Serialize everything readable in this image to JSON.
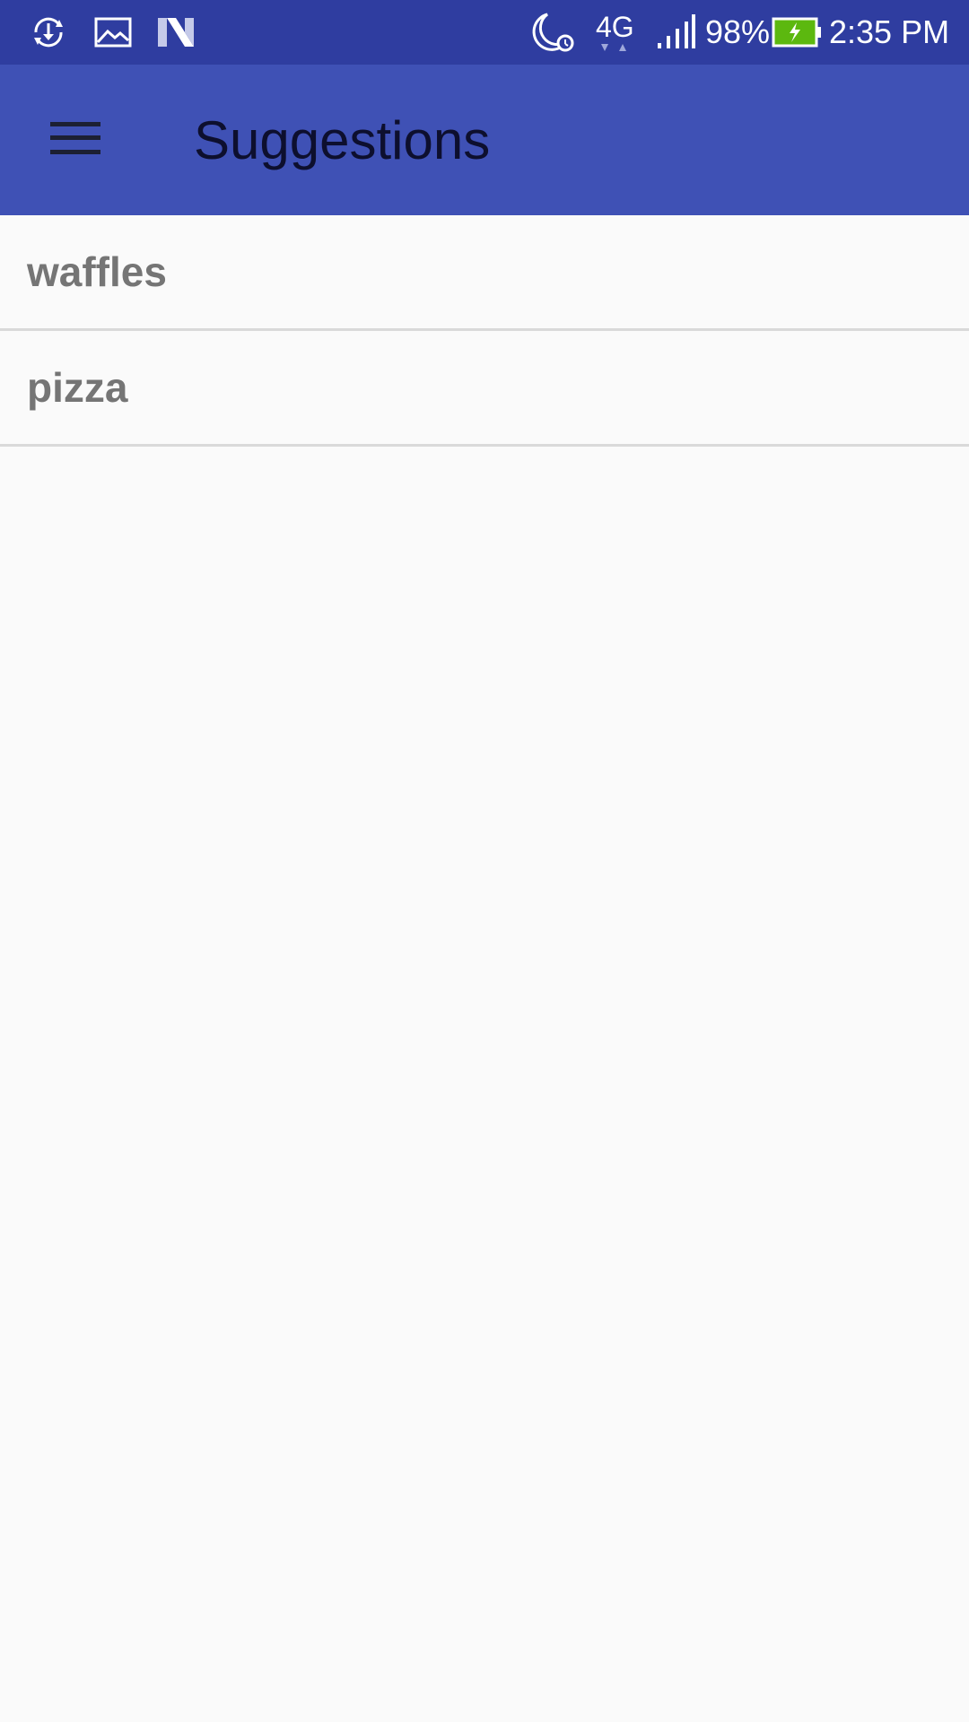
{
  "status_bar": {
    "left_icons": [
      "sync-download-icon",
      "image-icon",
      "n-logo-icon"
    ],
    "right_icons": [
      "moon-alarm-icon",
      "network-4g-icon",
      "signal-icon",
      "battery-charging-icon"
    ],
    "network_label": "4G",
    "battery_percent": "98%",
    "time": "2:35 PM",
    "colors": {
      "background": "#2f3da0",
      "battery_fill": "#5cb80f"
    }
  },
  "app_bar": {
    "title": "Suggestions",
    "menu_icon": "hamburger-menu-icon",
    "colors": {
      "background": "#3f51b5",
      "title": "#0d0f2e"
    }
  },
  "suggestions": {
    "items": [
      {
        "label": "waffles"
      },
      {
        "label": "pizza"
      }
    ]
  }
}
